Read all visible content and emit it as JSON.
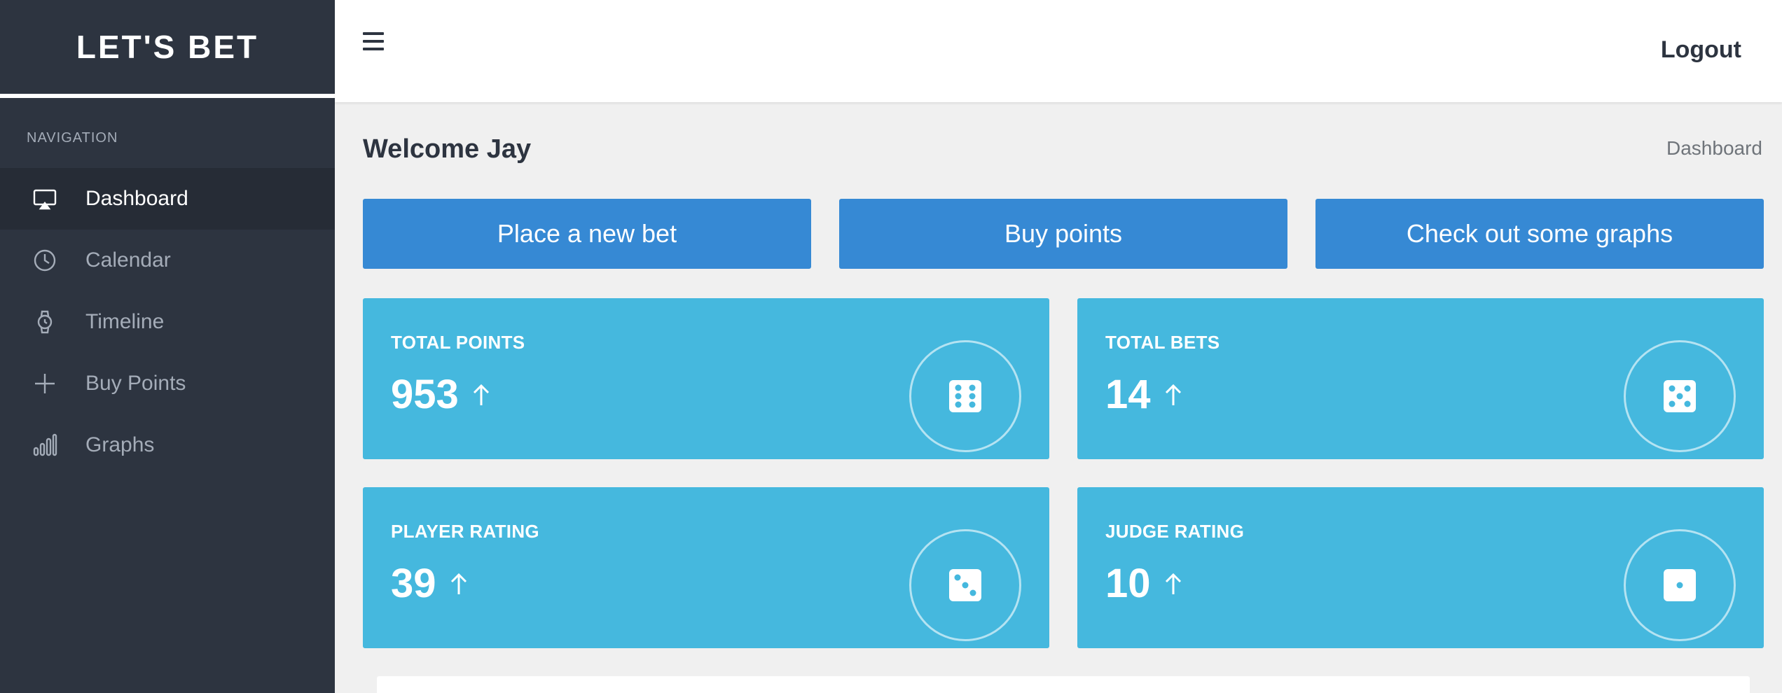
{
  "brand": "LET'S BET",
  "nav": {
    "heading": "NAVIGATION",
    "items": [
      {
        "label": "Dashboard",
        "icon": "monitor-icon",
        "active": true
      },
      {
        "label": "Calendar",
        "icon": "clock-icon",
        "active": false
      },
      {
        "label": "Timeline",
        "icon": "watch-icon",
        "active": false
      },
      {
        "label": "Buy Points",
        "icon": "plus-icon",
        "active": false
      },
      {
        "label": "Graphs",
        "icon": "bar-chart-icon",
        "active": false
      }
    ]
  },
  "topbar": {
    "menu_icon": "hamburger-icon",
    "logout_label": "Logout"
  },
  "page": {
    "title": "Welcome Jay",
    "breadcrumb": "Dashboard"
  },
  "actions": [
    {
      "label": "Place a new bet"
    },
    {
      "label": "Buy points"
    },
    {
      "label": "Check out some graphs"
    }
  ],
  "stats": [
    {
      "label": "TOTAL POINTS",
      "value": "953",
      "trend_icon": "arrow-up-icon",
      "icon": "dice-six-icon"
    },
    {
      "label": "TOTAL BETS",
      "value": "14",
      "trend_icon": "arrow-up-icon",
      "icon": "dice-five-icon"
    },
    {
      "label": "PLAYER RATING",
      "value": "39",
      "trend_icon": "arrow-up-icon",
      "icon": "dice-three-icon"
    },
    {
      "label": "JUDGE RATING",
      "value": "10",
      "trend_icon": "arrow-up-icon",
      "icon": "dice-one-icon"
    }
  ],
  "colors": {
    "sidebar_bg": "#2d3440",
    "sidebar_active_bg": "#262c36",
    "primary_button": "#3689d4",
    "stat_card": "#45b8de",
    "page_bg": "#f0f0f0"
  }
}
